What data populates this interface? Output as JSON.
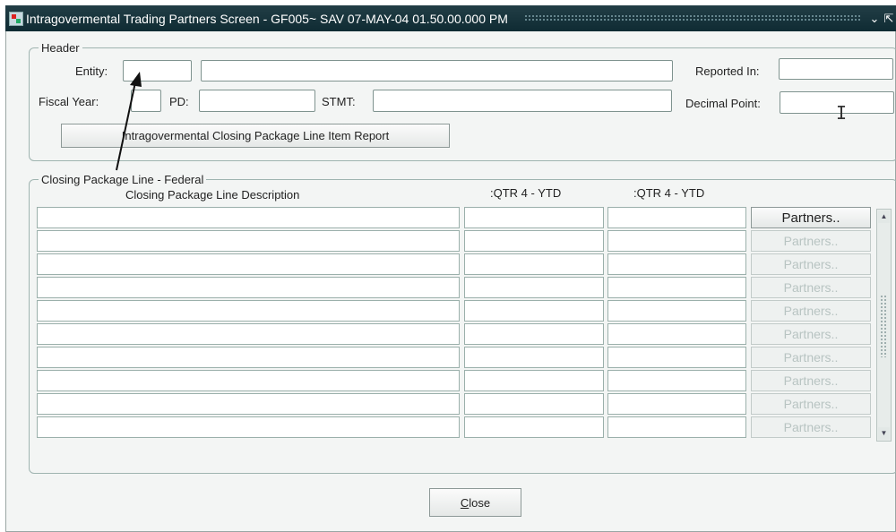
{
  "title_bar": {
    "title": "Intragovermental Trading Partners Screen - GF005~ SAV 07-MAY-04 01.50.00.000 PM",
    "minimize_glyph": "⌄",
    "maximize_glyph": "⇱"
  },
  "header": {
    "legend": "Header",
    "entity_label": "Entity:",
    "reported_in_label": "Reported In:",
    "fiscal_year_label": "Fiscal Year:",
    "pd_label": "PD:",
    "stmt_label": "STMT:",
    "decimal_point_label": "Decimal Point:",
    "report_button": "Intragovermental Closing Package Line Item Report"
  },
  "closing_package": {
    "legend": "Closing Package Line - Federal",
    "columns": [
      "Closing Package Line Description",
      ":QTR 4 - YTD",
      ":QTR 4 - YTD"
    ],
    "partners_buttons": [
      "Partners..",
      "Partners..",
      "Partners..",
      "Partners..",
      "Partners..",
      "Partners..",
      "Partners..",
      "Partners..",
      "Partners..",
      "Partners.."
    ]
  },
  "footer": {
    "close_button": "Close"
  }
}
